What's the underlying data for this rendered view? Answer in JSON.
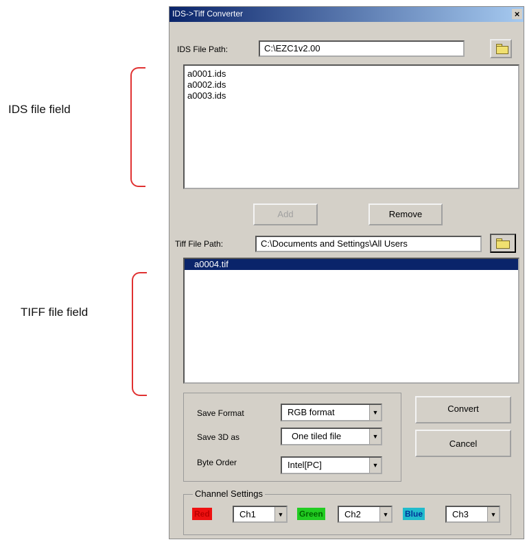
{
  "annotations": {
    "ids_label": "IDS file field",
    "tiff_label": "TIFF file field"
  },
  "window": {
    "title": "IDS->Tiff Converter",
    "close_label": "×"
  },
  "ids": {
    "path_label": "IDS File Path:",
    "path_value": "C:\\EZC1v2.00",
    "files": [
      "a0001.ids",
      "a0002.ids",
      "a0003.ids"
    ]
  },
  "buttons": {
    "add": "Add",
    "remove": "Remove",
    "convert": "Convert",
    "cancel": "Cancel"
  },
  "tiff": {
    "path_label": "Tiff File Path:",
    "path_value": "C:\\Documents and Settings\\All Users",
    "files": [
      "a0004.tif"
    ],
    "selected_index": 0
  },
  "options": {
    "save_format_label": "Save Format",
    "save_format_value": "RGB format",
    "save_3d_label": "Save 3D as",
    "save_3d_value": "One tiled file",
    "byte_order_label": "Byte Order",
    "byte_order_value": "Intel[PC]"
  },
  "channels": {
    "group_label": "Channel Settings",
    "red_label": "Red",
    "red_value": "Ch1",
    "green_label": "Green",
    "green_value": "Ch2",
    "blue_label": "Blue",
    "blue_value": "Ch3"
  },
  "colors": {
    "red": "#ee1111",
    "green": "#22cc22",
    "blue": "#22bbcc",
    "selection": "#0a246a",
    "brace": "#e03030"
  },
  "icons": {
    "folder": "folder-icon",
    "dropdown": "chevron-down-icon"
  }
}
